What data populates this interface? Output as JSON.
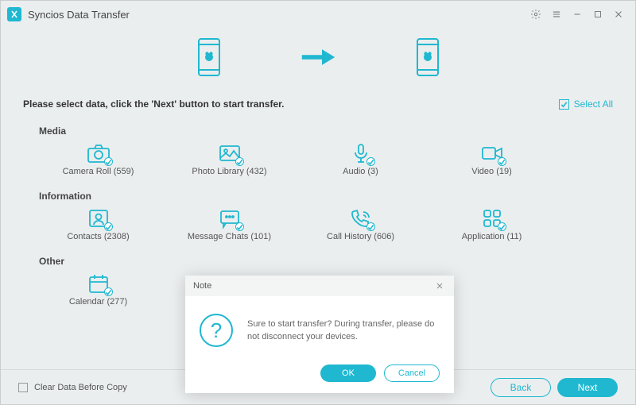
{
  "app": {
    "title": "Syncios Data Transfer"
  },
  "instruction": "Please select data, click the 'Next' button to start transfer.",
  "select_all": "Select All",
  "sections": {
    "media": {
      "title": "Media",
      "items": [
        {
          "label": "Camera Roll (559)"
        },
        {
          "label": "Photo Library (432)"
        },
        {
          "label": "Audio (3)"
        },
        {
          "label": "Video (19)"
        }
      ]
    },
    "information": {
      "title": "Information",
      "items": [
        {
          "label": "Contacts (2308)"
        },
        {
          "label": "Message Chats (101)"
        },
        {
          "label": "Call History (606)"
        },
        {
          "label": "Application (11)"
        }
      ]
    },
    "other": {
      "title": "Other",
      "items": [
        {
          "label": "Calendar (277)"
        }
      ]
    }
  },
  "footer": {
    "clear": "Clear Data Before Copy",
    "back": "Back",
    "next": "Next"
  },
  "dialog": {
    "title": "Note",
    "message": "Sure to start transfer? During transfer, please do not disconnect your devices.",
    "ok": "OK",
    "cancel": "Cancel"
  },
  "colors": {
    "accent": "#1fb8d0"
  }
}
